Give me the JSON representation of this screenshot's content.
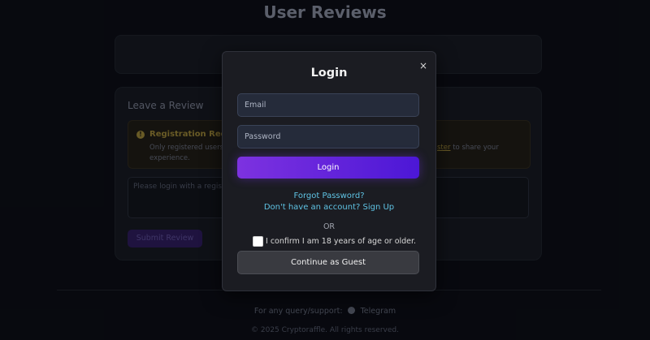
{
  "page": {
    "title": "User Reviews"
  },
  "review": {
    "heading": "Leave a Review",
    "notice_title": "Registration Required",
    "notice_line1": "Only registered users w",
    "notice_register_link": "ster",
    "notice_tail": "to share your",
    "notice_line2": "experience.",
    "textarea_placeholder": "Please login with a regist",
    "submit_label": "Submit Review"
  },
  "footer": {
    "support_text": "For any query/support:",
    "telegram_label": "Telegram",
    "copyright": "© 2025 Cryptoraffle. All rights reserved."
  },
  "modal": {
    "close_symbol": "×",
    "title": "Login",
    "email_placeholder": "Email",
    "password_placeholder": "Password",
    "login_label": "Login",
    "forgot_password": "Forgot Password?",
    "signup_prompt": "Don't have an account? Sign Up",
    "or_text": "OR",
    "age_confirm": "I confirm I am 18 years of age or older.",
    "age_checked": false,
    "guest_label": "Continue as Guest"
  },
  "colors": {
    "accent_gradient_start": "#7d32e0",
    "accent_gradient_end": "#4c17d6",
    "link": "#5fc3e4",
    "warning": "#8d7a33",
    "background": "#0b0d14"
  },
  "icons": {
    "notice": "info-icon",
    "support": "telegram-icon",
    "close": "close-icon"
  }
}
